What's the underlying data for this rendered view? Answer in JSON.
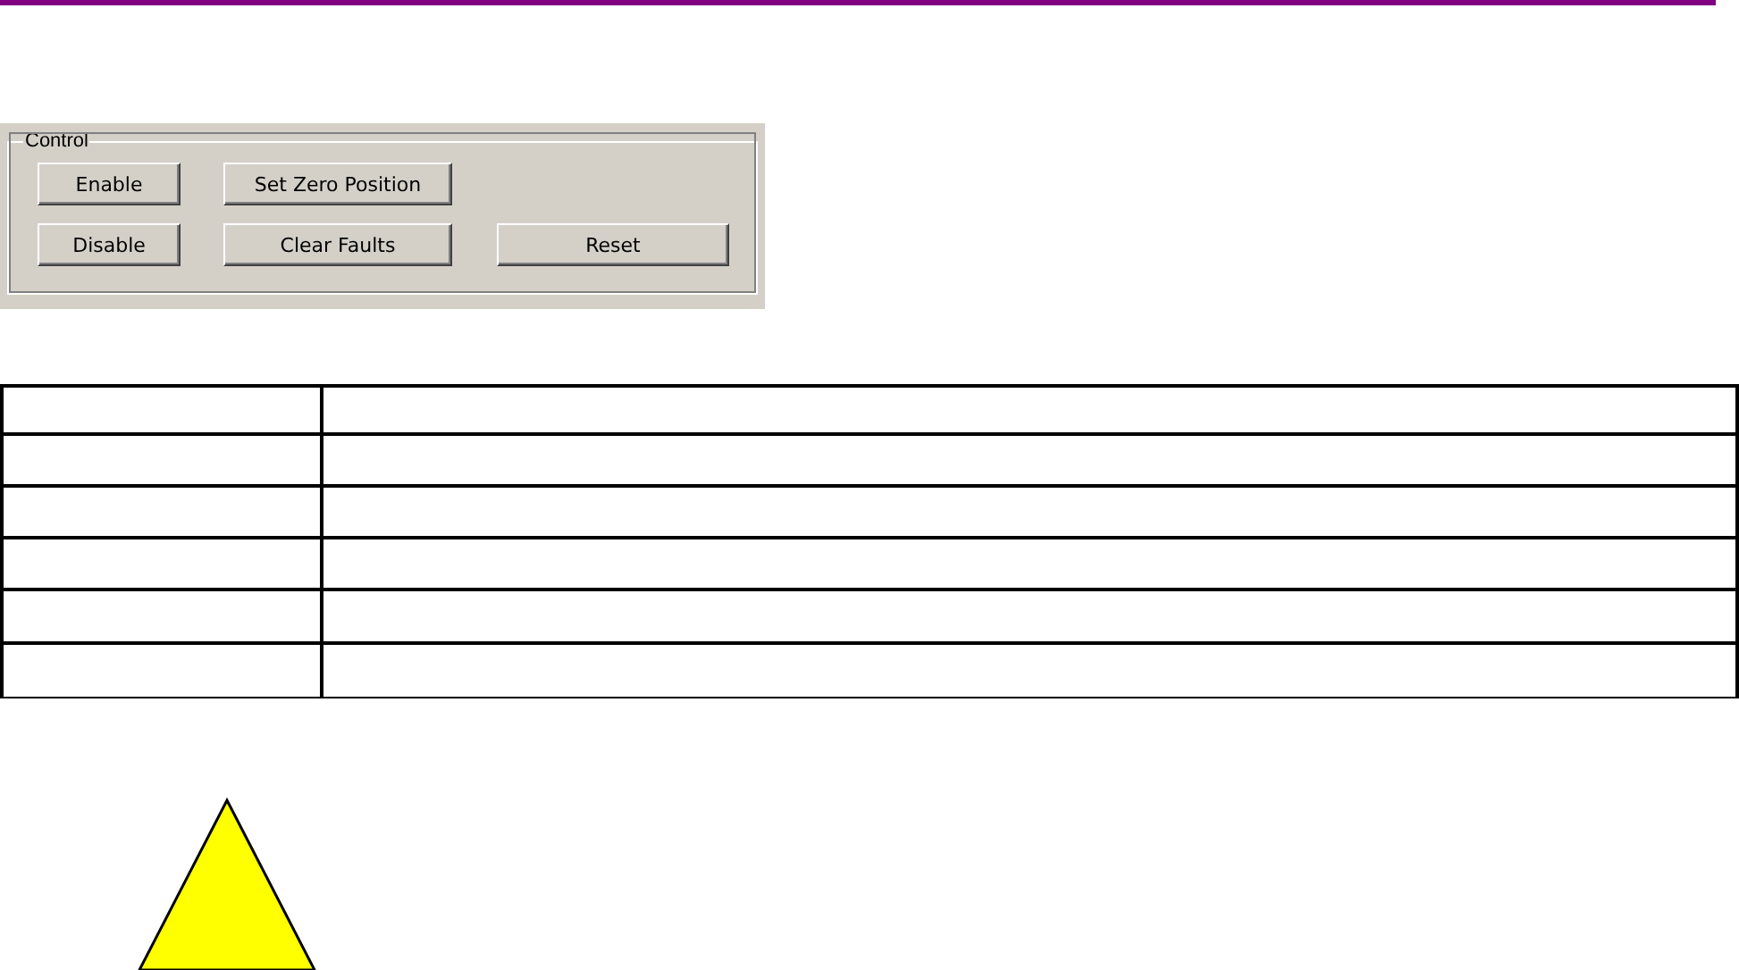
{
  "control_group": {
    "title": "Control",
    "buttons": [
      {
        "label": "Enable"
      },
      {
        "label": "Set Zero Position"
      },
      {
        "label": "Disable"
      },
      {
        "label": "Clear Faults"
      },
      {
        "label": "Reset"
      }
    ]
  }
}
